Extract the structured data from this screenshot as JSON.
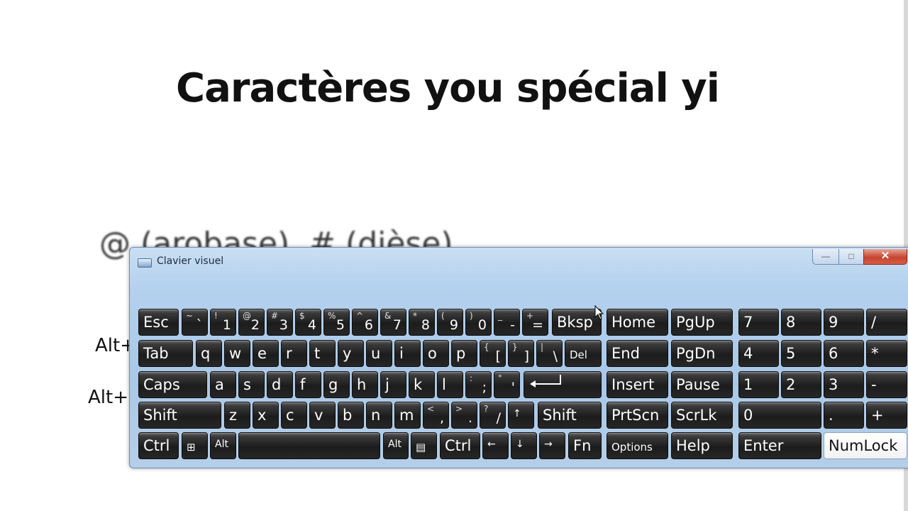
{
  "slide": {
    "title": "Caractères you spécial yi",
    "subtitle": "@ (arobase), # (dièse)",
    "alt_line_1": "Alt+",
    "alt_line_2": "Alt+"
  },
  "osk": {
    "title": "Clavier visuel",
    "icon": "keyboard-icon",
    "buttons": {
      "minimize": "—",
      "maximize": "□",
      "close": "✕"
    }
  },
  "keys": {
    "esc": "Esc",
    "tilde": {
      "top": "~",
      "bottom": "`"
    },
    "k1": {
      "top": "!",
      "bottom": "1"
    },
    "k2": {
      "top": "@",
      "bottom": "2"
    },
    "k3": {
      "top": "#",
      "bottom": "3"
    },
    "k4": {
      "top": "$",
      "bottom": "4"
    },
    "k5": {
      "top": "%",
      "bottom": "5"
    },
    "k6": {
      "top": "^",
      "bottom": "6"
    },
    "k7": {
      "top": "&",
      "bottom": "7"
    },
    "k8": {
      "top": "*",
      "bottom": "8"
    },
    "k9": {
      "top": "(",
      "bottom": "9"
    },
    "k0": {
      "top": ")",
      "bottom": "0"
    },
    "minus": {
      "top": "_",
      "bottom": "-"
    },
    "equals": {
      "top": "+",
      "bottom": "="
    },
    "bksp": "Bksp",
    "home": "Home",
    "pgup": "PgUp",
    "tab": "Tab",
    "q": "q",
    "w": "w",
    "e": "e",
    "r": "r",
    "t": "t",
    "y": "y",
    "u": "u",
    "i": "i",
    "o": "o",
    "p": "p",
    "lbracket": {
      "top": "{",
      "bottom": "["
    },
    "rbracket": {
      "top": "}",
      "bottom": "]"
    },
    "backslash": {
      "top": "|",
      "bottom": "\\"
    },
    "del": "Del",
    "end": "End",
    "pgdn": "PgDn",
    "caps": "Caps",
    "a": "a",
    "s": "s",
    "d": "d",
    "f": "f",
    "g": "g",
    "h": "h",
    "j": "j",
    "k": "k",
    "l": "l",
    "semicolon": {
      "top": ":",
      "bottom": ";"
    },
    "quote": {
      "top": "\"",
      "bottom": "'"
    },
    "insert": "Insert",
    "pause": "Pause",
    "lshift": "Shift",
    "z": "z",
    "x": "x",
    "c": "c",
    "v": "v",
    "b": "b",
    "n": "n",
    "m": "m",
    "comma": {
      "top": "<",
      "bottom": ","
    },
    "period": {
      "top": ">",
      "bottom": "."
    },
    "slash": {
      "top": "?",
      "bottom": "/"
    },
    "up": "↑",
    "rshift": "Shift",
    "prtscn": "PrtScn",
    "scrlk": "ScrLk",
    "ctrl_l": "Ctrl",
    "win": "⊞",
    "alt_l": "Alt",
    "alt_r": "Alt",
    "menu": "▤",
    "ctrl_r": "Ctrl",
    "left": "←",
    "down": "↓",
    "right": "→",
    "fn": "Fn",
    "options": "Options",
    "help": "Help",
    "n7": "7",
    "n8": "8",
    "n9": "9",
    "ndiv": "/",
    "n4": "4",
    "n5": "5",
    "n6": "6",
    "nmul": "*",
    "n1": "1",
    "n2": "2",
    "n3": "3",
    "nsub": "-",
    "n0": "0",
    "ndot": ".",
    "nadd": "+",
    "enter": "Enter",
    "numlock": "NumLock"
  }
}
